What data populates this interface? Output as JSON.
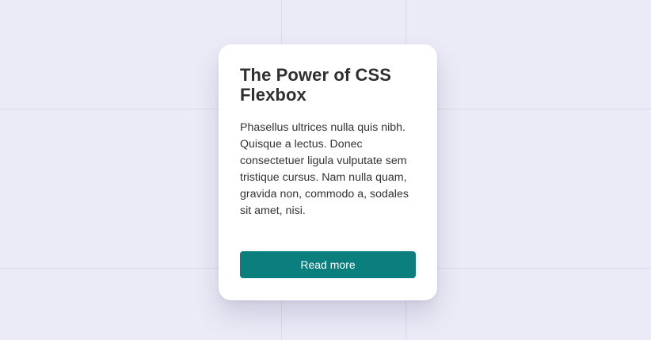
{
  "card": {
    "title": "The Power of CSS Flexbox",
    "body": "Phasellus ultrices nulla quis nibh. Quisque a lectus. Donec consectetuer ligula vulputate sem tristique cursus. Nam nulla quam, gravida non, commodo a, sodales sit amet, nisi.",
    "button_label": "Read more"
  },
  "colors": {
    "background": "#ebebf7",
    "card": "#ffffff",
    "accent": "#0a7f7e",
    "title_text": "#2f2f2f",
    "body_text": "#333333"
  }
}
